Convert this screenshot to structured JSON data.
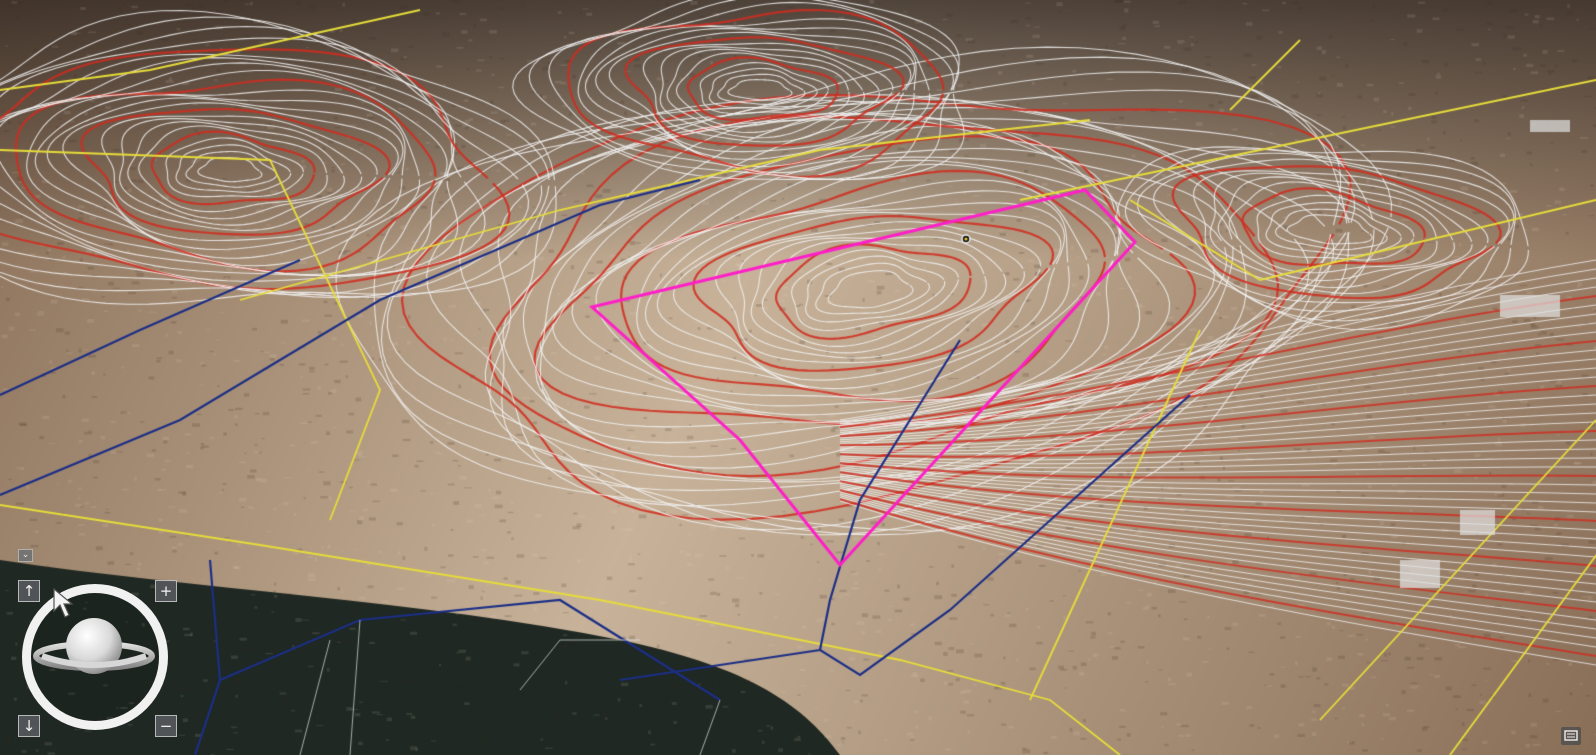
{
  "map": {
    "type": "3D terrain scene",
    "basemap": "satellite imagery",
    "layers": [
      {
        "name": "contours-minor",
        "color": "#f2f2f2"
      },
      {
        "name": "contours-index",
        "color": "#d12b1f"
      },
      {
        "name": "parcel-lines",
        "color": "#e6dc3a"
      },
      {
        "name": "boundary-lines",
        "color": "#1c2f86"
      },
      {
        "name": "selected-parcel",
        "color": "#ff1fc8"
      }
    ],
    "point_label": "· · · ·"
  },
  "navigation": {
    "pan_up_glyph": "↑",
    "pan_down_glyph": "↓",
    "zoom_in_glyph": "+",
    "zoom_out_glyph": "−",
    "collapse_glyph": "⌄",
    "icons": [
      "pan-up-icon",
      "pan-down-icon",
      "zoom-in-icon",
      "zoom-out-icon",
      "compass-ring",
      "globe-icon",
      "collapse-icon",
      "pointer-cursor-icon",
      "tool-icon"
    ]
  },
  "colors": {
    "terrain_light": "#c8b39a",
    "terrain_mid": "#8a6f58",
    "water": "#1f2822",
    "accent_top": "#2e6fd0"
  }
}
